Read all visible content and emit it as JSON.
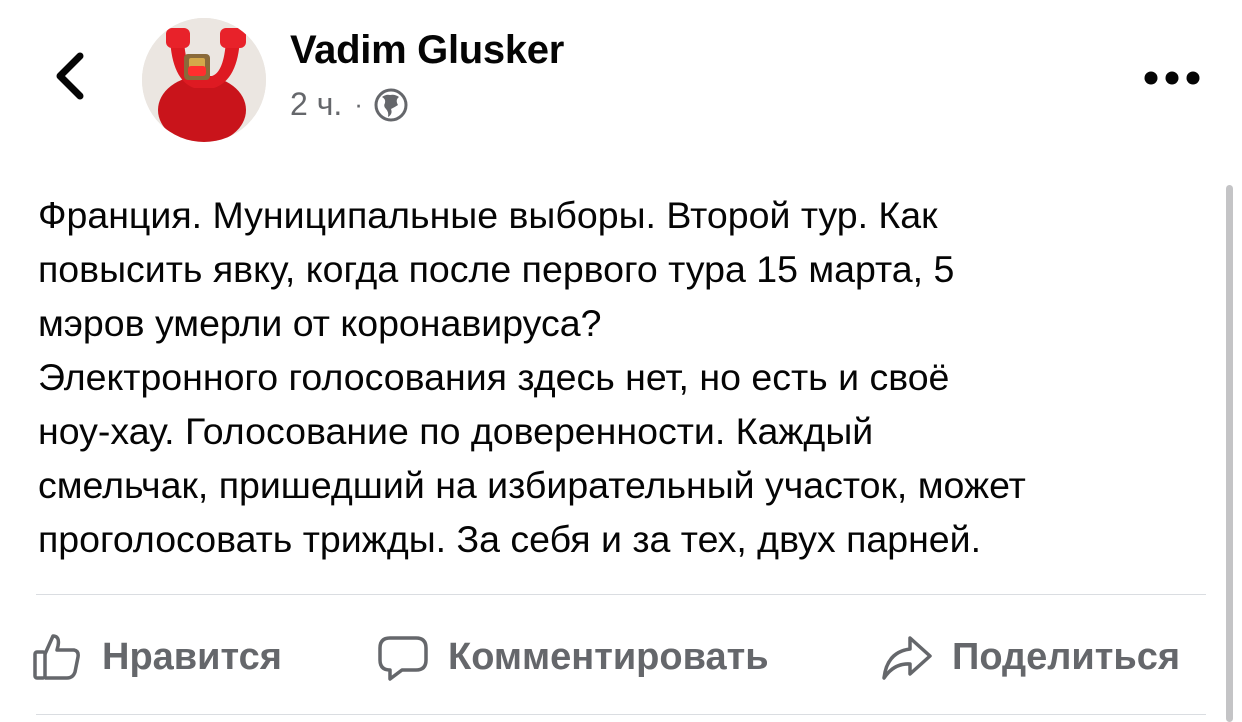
{
  "header": {
    "author_name": "Vadim Glusker",
    "timestamp": "2 ч.",
    "separator": "·",
    "audience_icon": "globe-icon",
    "back_icon": "chevron-left-icon",
    "more_icon": "more-horizontal-icon"
  },
  "post": {
    "text": "Франция. Муниципальные выборы. Второй тур. Как\nповысить явку, когда после первого тура 15 марта, 5\nмэров умерли от коронавируса?\nЭлектронного голосования здесь нет, но есть и своё\nноу-хау. Голосование по доверенности. Каждый\nсмельчак, пришедший на избирательный участок, может\nпроголосовать трижды. За себя и за тех, двух парней."
  },
  "actions": {
    "like_label": "Нравится",
    "comment_label": "Комментировать",
    "share_label": "Поделиться",
    "like_icon": "thumbs-up-icon",
    "comment_icon": "comment-bubble-icon",
    "share_icon": "share-arrow-icon"
  },
  "colors": {
    "text_primary": "#050505",
    "text_secondary": "#65676b",
    "divider": "#dadde1",
    "avatar_accent": "#d6161c"
  }
}
